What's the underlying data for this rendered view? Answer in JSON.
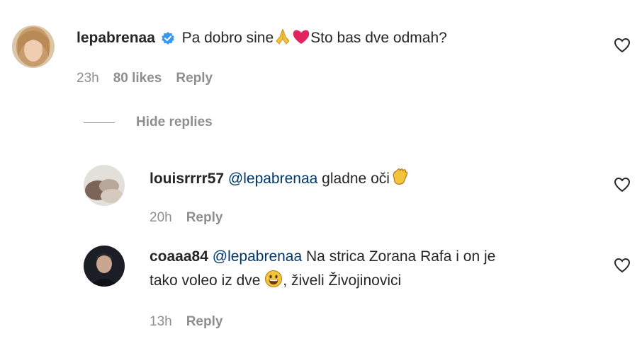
{
  "comments": [
    {
      "username": "lepabrenaa",
      "verified": true,
      "text_before": "Pa dobro sine",
      "emoji_1": "folded-hands",
      "emoji_2": "red-heart",
      "text_after": "Sto bas dve odmah?",
      "time": "23h",
      "likes": "80 likes",
      "reply_label": "Reply"
    }
  ],
  "hide_replies_label": "Hide replies",
  "replies": [
    {
      "username": "louisrrrr57",
      "mention": "@lepabrenaa",
      "text": "gladne oči",
      "emoji": "waving-hand",
      "time": "20h",
      "reply_label": "Reply"
    },
    {
      "username": "coaaa84",
      "mention": "@lepabrenaa",
      "text_line1": "Na strica Zorana Rafa i on je",
      "text_line2_before": "tako voleo iz dve",
      "emoji": "grinning-face",
      "text_line2_after": ", živeli Živojinovici",
      "time": "13h",
      "reply_label": "Reply"
    }
  ],
  "colors": {
    "text": "#262626",
    "secondary": "#8e8e8e",
    "mention": "#00376b",
    "verified": "#3897f0"
  }
}
